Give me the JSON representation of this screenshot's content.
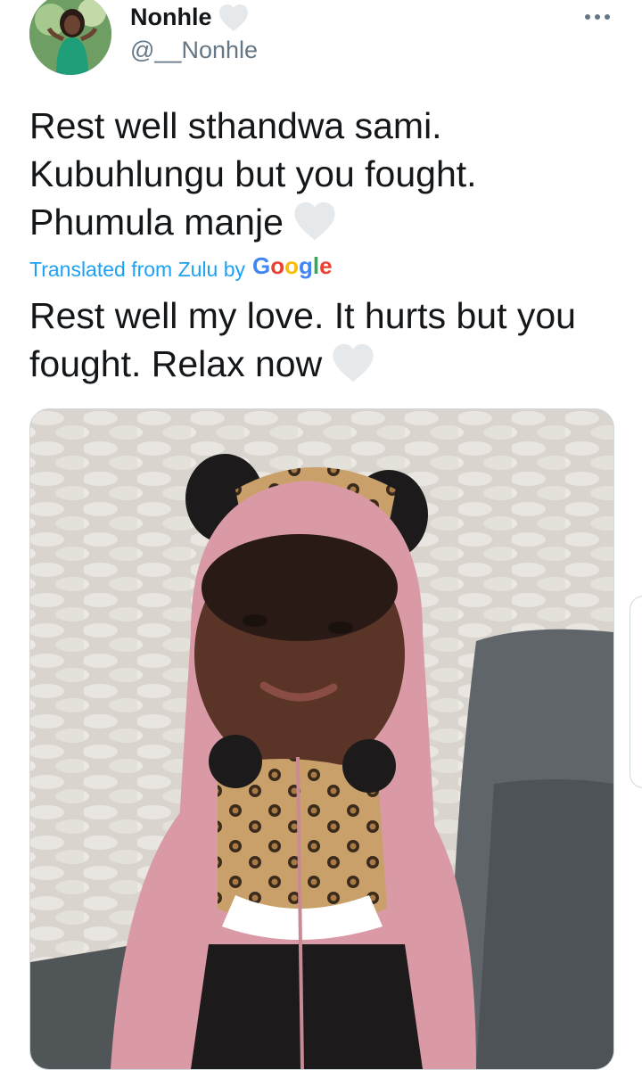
{
  "tweet": {
    "author_name": "Nonhle",
    "author_handle": "@__Nonhle",
    "text_lines": [
      "Rest well sthandwa sami.",
      "Kubuhlungu but you fought.",
      "Phumula manje"
    ],
    "translated_prefix": "Translated from Zulu by",
    "translator": "Google",
    "translation_lines": [
      "Rest well my love. It hurts but you",
      "fought. Relax now"
    ]
  },
  "icons": {
    "name_badge": "white-heart-icon",
    "more": "more-dots-icon",
    "inline": "white-heart-icon"
  },
  "colors": {
    "text": "#14171a",
    "secondary": "#657786",
    "link": "#1da1f2",
    "heart": "#e6e9eb"
  }
}
